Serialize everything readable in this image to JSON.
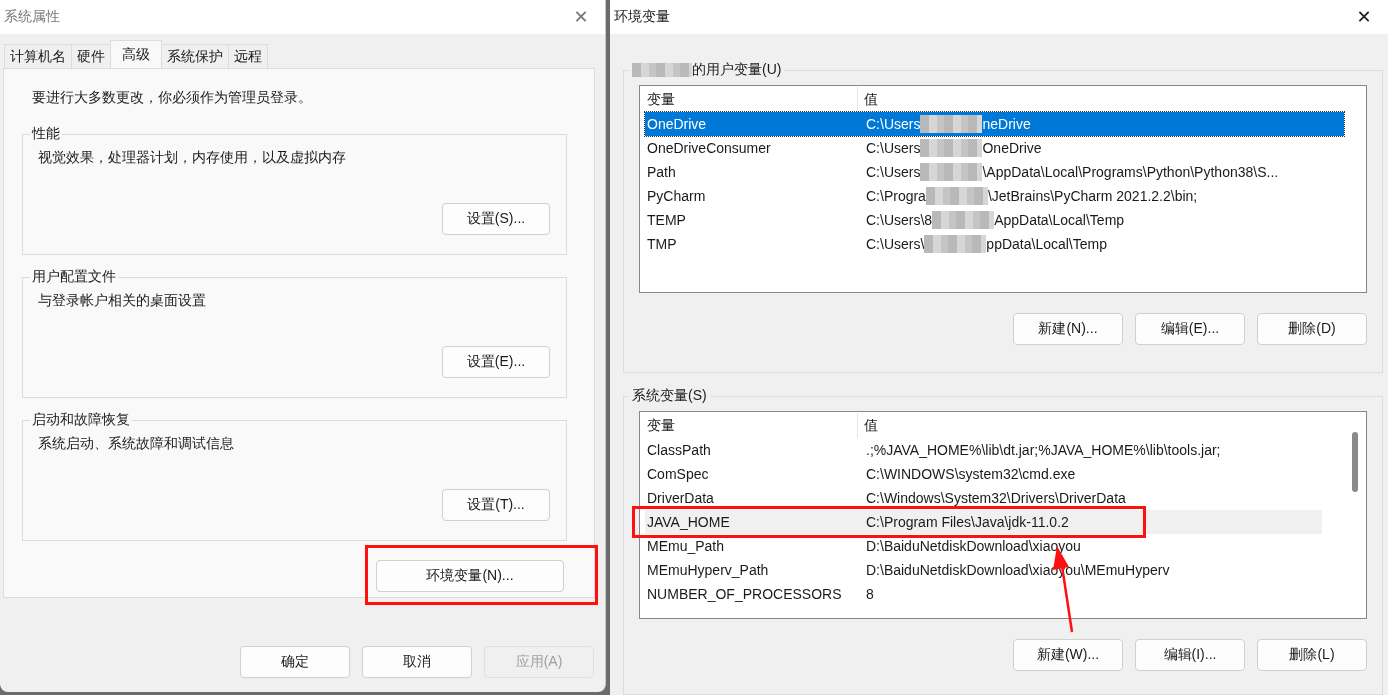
{
  "system_properties": {
    "title": "系统属性",
    "close": "✕",
    "tabs": [
      {
        "label": "计算机名",
        "selected": false
      },
      {
        "label": "硬件",
        "selected": false
      },
      {
        "label": "高级",
        "selected": true
      },
      {
        "label": "系统保护",
        "selected": false
      },
      {
        "label": "远程",
        "selected": false
      }
    ],
    "notice": "要进行大多数更改，你必须作为管理员登录。",
    "groups": [
      {
        "title": "性能",
        "description": "视觉效果，处理器计划，内存使用，以及虚拟内存",
        "button": "设置(S)..."
      },
      {
        "title": "用户配置文件",
        "description": "与登录帐户相关的桌面设置",
        "button": "设置(E)..."
      },
      {
        "title": "启动和故障恢复",
        "description": "系统启动、系统故障和调试信息",
        "button": "设置(T)..."
      }
    ],
    "env_button": "环境变量(N)...",
    "footer_buttons": [
      {
        "label": "确定",
        "disabled": false
      },
      {
        "label": "取消",
        "disabled": false
      },
      {
        "label": "应用(A)",
        "disabled": true
      }
    ]
  },
  "environment_variables": {
    "title": "环境变量",
    "close": "✕",
    "sections": [
      {
        "title": "的用户变量(U)",
        "owner_redacted": true,
        "focused": true,
        "scrollbar": false,
        "columns": [
          "变量",
          "值"
        ],
        "rows": [
          {
            "name": "OneDrive",
            "value_start": "C:\\Users",
            "value_end": "neDrive",
            "redacted": true,
            "selected": true
          },
          {
            "name": "OneDriveConsumer",
            "value_start": "C:\\Users",
            "value_end": "OneDrive",
            "redacted": true,
            "selected": false
          },
          {
            "name": "Path",
            "value_start": "C:\\Users",
            "value_end": "\\AppData\\Local\\Programs\\Python\\Python38\\S...",
            "redacted": true,
            "selected": false
          },
          {
            "name": "PyCharm",
            "value_start": "C:\\Progra",
            "value_end": "\\JetBrains\\PyCharm 2021.2.2\\bin;",
            "redacted": true,
            "selected": false
          },
          {
            "name": "TEMP",
            "value_start": "C:\\Users\\8",
            "value_end": "AppData\\Local\\Temp",
            "redacted": true,
            "selected": false
          },
          {
            "name": "TMP",
            "value_start": "C:\\Users\\",
            "value_end": "ppData\\Local\\Temp",
            "redacted": true,
            "selected": false
          }
        ],
        "buttons": [
          "新建(N)...",
          "编辑(E)...",
          "删除(D)"
        ]
      },
      {
        "title": "系统变量(S)",
        "owner_redacted": false,
        "focused": false,
        "scrollbar": true,
        "columns": [
          "变量",
          "值"
        ],
        "rows": [
          {
            "name": "ClassPath",
            "value_start": ".;%JAVA_HOME%\\lib\\dt.jar;%JAVA_HOME%\\lib\\tools.jar;",
            "redacted": false,
            "selected": false
          },
          {
            "name": "ComSpec",
            "value_start": "C:\\WINDOWS\\system32\\cmd.exe",
            "redacted": false,
            "selected": false
          },
          {
            "name": "DriverData",
            "value_start": "C:\\Windows\\System32\\Drivers\\DriverData",
            "redacted": false,
            "selected": false
          },
          {
            "name": "JAVA_HOME",
            "value_start": "C:\\Program Files\\Java\\jdk-11.0.2",
            "redacted": false,
            "selected": true
          },
          {
            "name": "MEmu_Path",
            "value_start": "D:\\BaiduNetdiskDownload\\xiaoyou",
            "redacted": false,
            "selected": false
          },
          {
            "name": "MEmuHyperv_Path",
            "value_start": "D:\\BaiduNetdiskDownload\\xiaoyou\\MEmuHyperv",
            "redacted": false,
            "selected": false
          },
          {
            "name": "NUMBER_OF_PROCESSORS",
            "value_start": "8",
            "redacted": false,
            "selected": false
          }
        ],
        "buttons": [
          "新建(W)...",
          "编辑(I)...",
          "删除(L)"
        ]
      }
    ]
  }
}
